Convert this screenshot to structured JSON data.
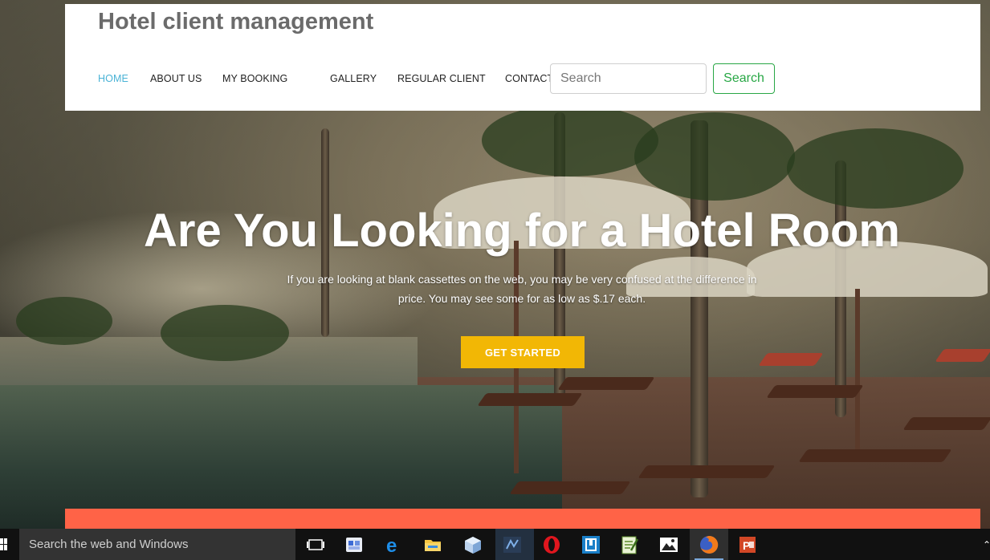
{
  "app": {
    "brand": "Hotel client management"
  },
  "nav": {
    "items": [
      {
        "label": "HOME",
        "active": true
      },
      {
        "label": "ABOUT US",
        "active": false
      },
      {
        "label": "MY BOOKING",
        "active": false
      },
      {
        "label": "GALLERY",
        "active": false
      },
      {
        "label": "REGULAR CLIENT",
        "active": false
      },
      {
        "label": "CONTACT",
        "active": false
      }
    ],
    "search": {
      "placeholder": "Search",
      "value": "",
      "button_label": "Search"
    }
  },
  "hero": {
    "title": "Are You Looking for a Hotel Room",
    "subtitle": "If you are looking at blank cassettes on the web, you may be very confused at the difference in price. You may see some for as low as $.17 each.",
    "cta_label": "GET STARTED"
  },
  "taskbar": {
    "search_placeholder": "Search the web and Windows",
    "apps": [
      "task-view-icon",
      "store-app-icon",
      "edge-browser-icon",
      "file-explorer-icon",
      "3d-app-icon",
      "code-editor-icon",
      "opera-browser-icon",
      "app-square-icon",
      "notepad-app-icon",
      "photos-app-icon",
      "firefox-browser-icon",
      "powerpoint-app-icon"
    ],
    "active_app": "firefox-browser-icon"
  },
  "colors": {
    "nav_active": "#4ab3d6",
    "search_button": "#28a745",
    "cta": "#f2b705",
    "accent_bar": "#ff6347",
    "brand_text": "#6b6b6b"
  }
}
